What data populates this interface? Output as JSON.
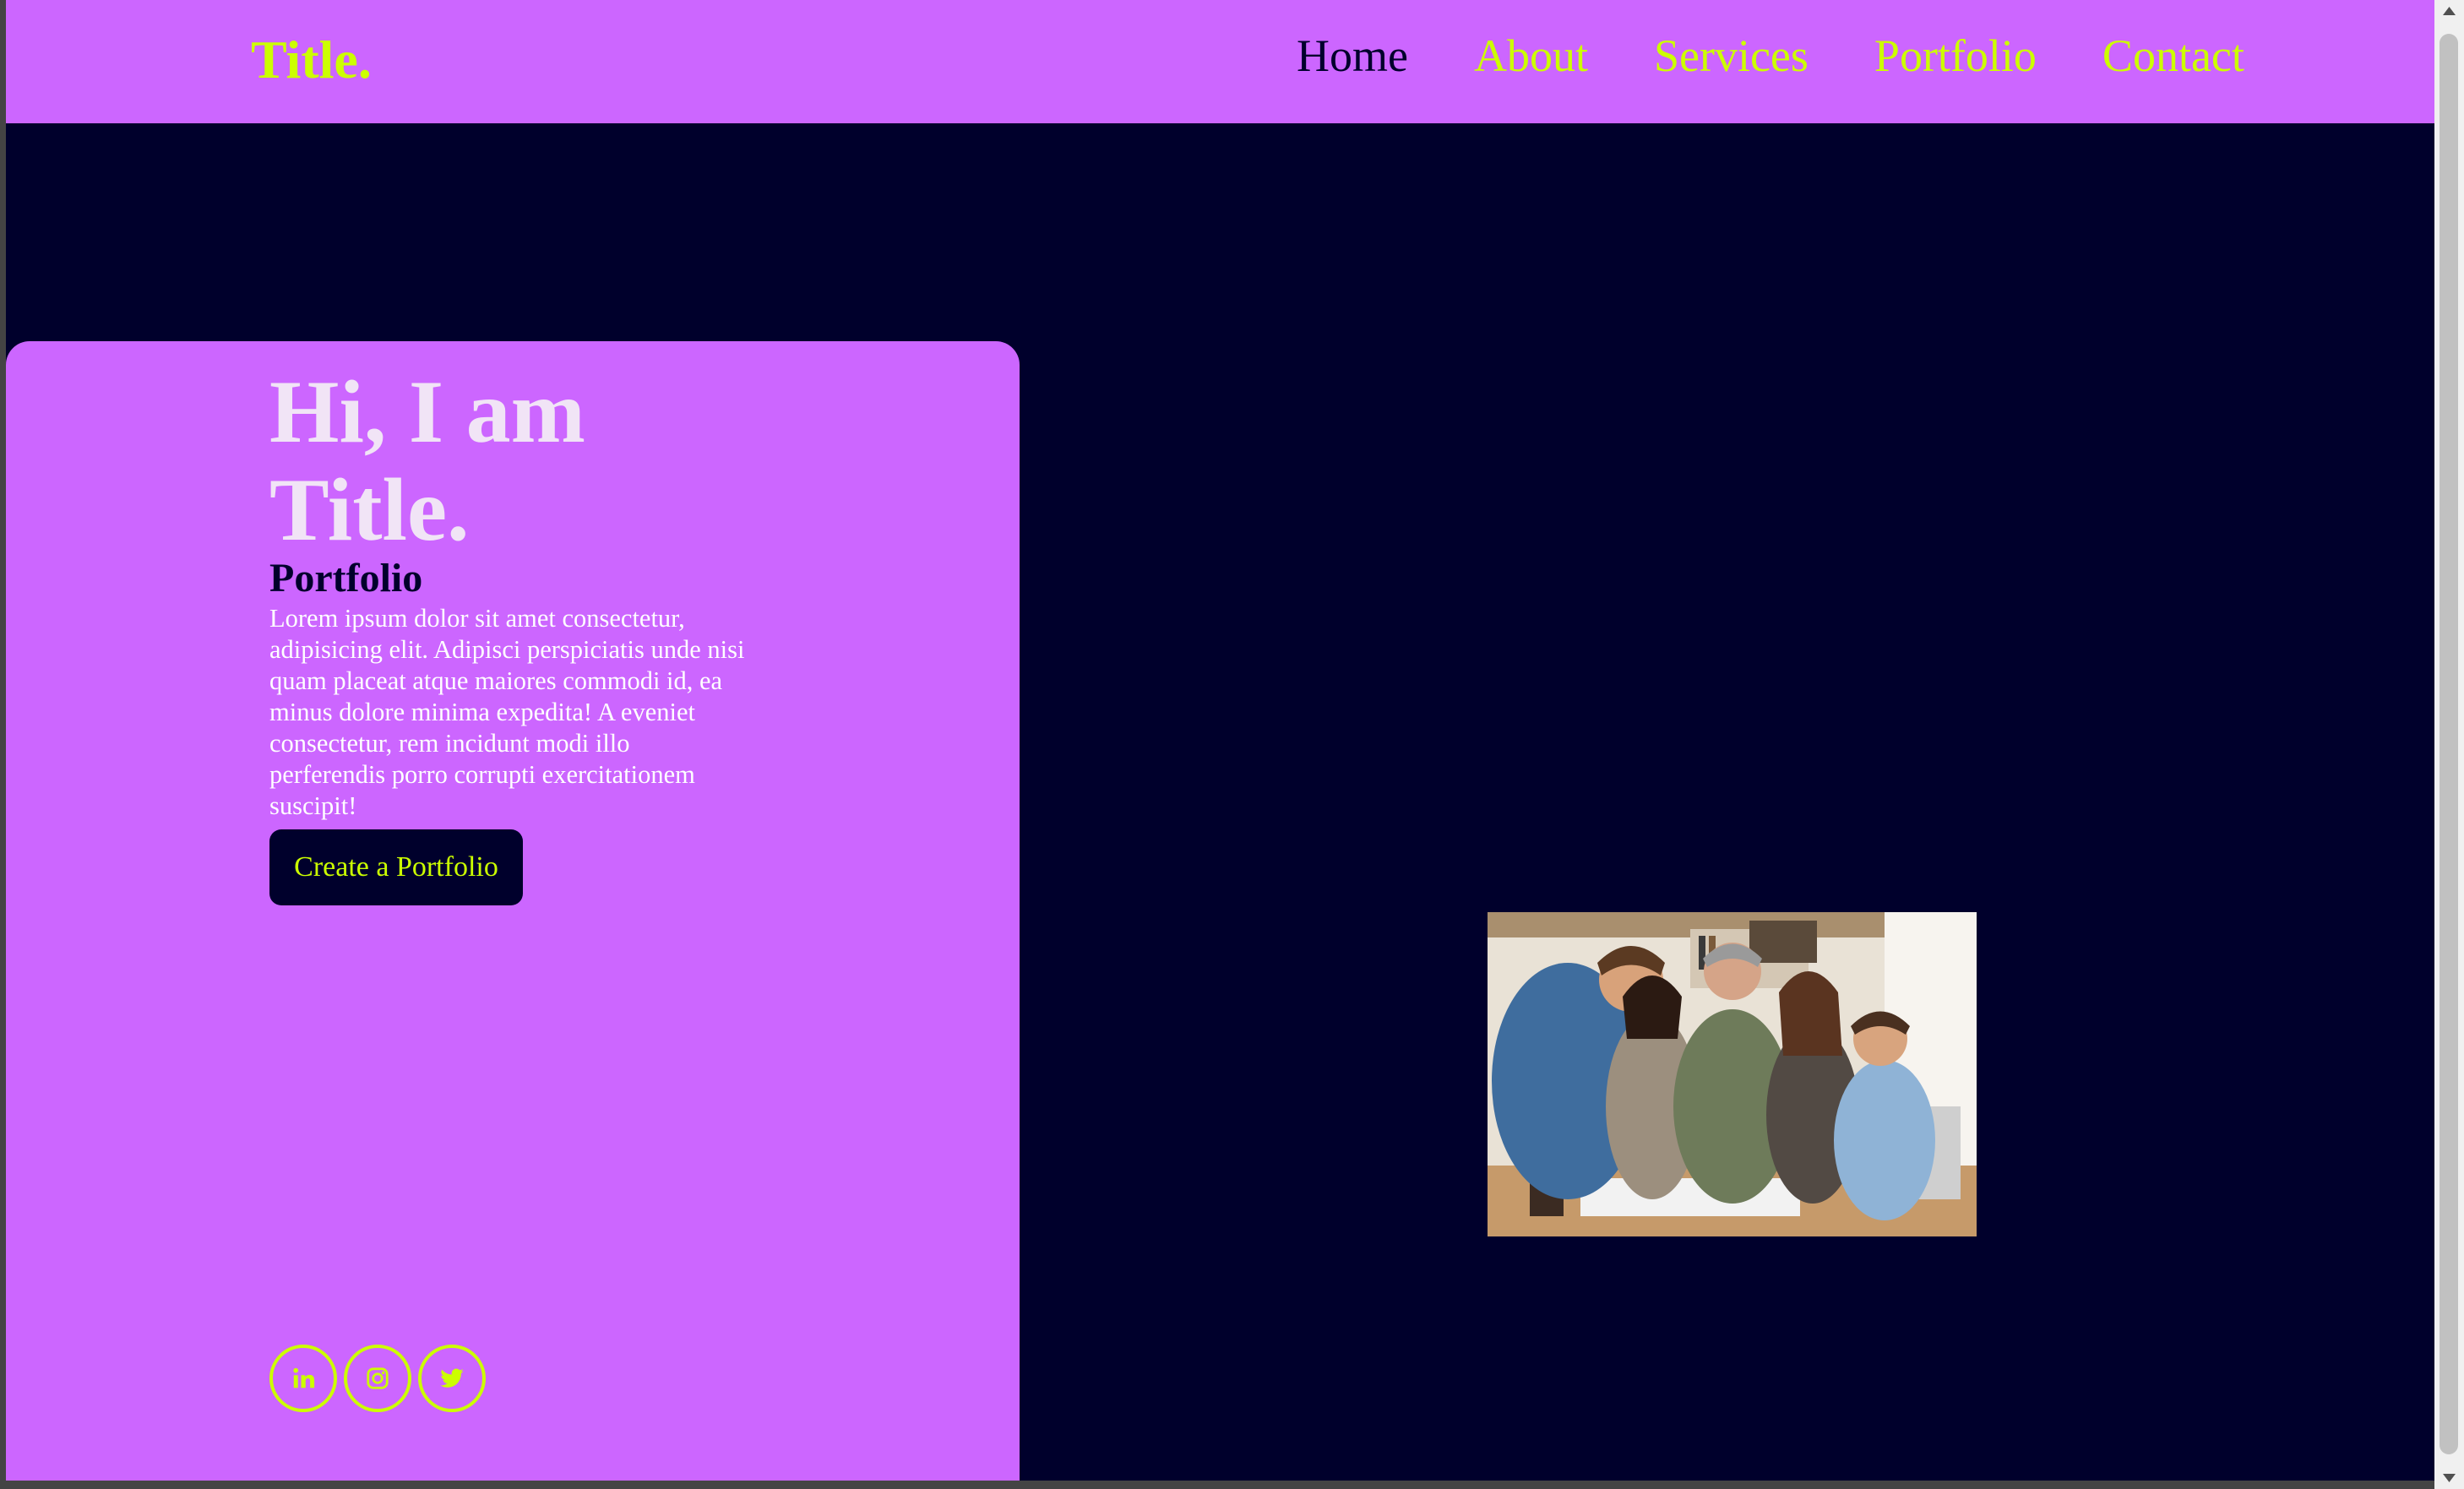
{
  "brand": {
    "name": "Title."
  },
  "nav": {
    "items": [
      {
        "label": "Home",
        "active": true
      },
      {
        "label": "About",
        "active": false
      },
      {
        "label": "Services",
        "active": false
      },
      {
        "label": "Portfolio",
        "active": false
      },
      {
        "label": "Contact",
        "active": false
      }
    ]
  },
  "hero": {
    "title": "Hi, I am Title.",
    "subtitle": "Portfolio",
    "description": "Lorem ipsum dolor sit amet consectetur, adipisicing elit. Adipisci perspiciatis unde nisi quam placeat atque maiores commodi id, ea minus dolore minima expedita! A eveniet consectetur, rem incidunt modi illo perferendis porro corrupti exercitationem suscipit!",
    "cta_label": "Create a Portfolio"
  },
  "socials": [
    {
      "name": "linkedin",
      "icon": "linkedin-icon"
    },
    {
      "name": "instagram",
      "icon": "instagram-icon"
    },
    {
      "name": "twitter",
      "icon": "twitter-icon"
    }
  ],
  "colors": {
    "primary": "#cc66ff",
    "accent": "#ccff00",
    "background": "#00002c",
    "hero_title": "#f1e4f6"
  }
}
